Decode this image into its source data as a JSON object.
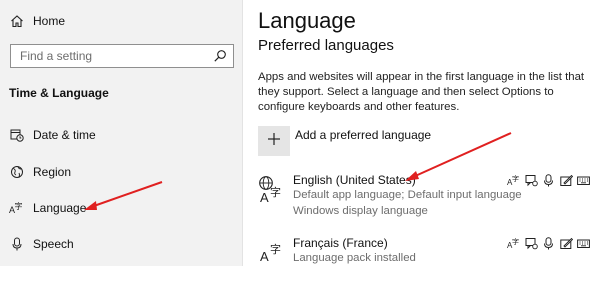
{
  "sidebar": {
    "home_label": "Home",
    "search_placeholder": "Find a setting",
    "section_title": "Time & Language",
    "items": [
      {
        "label": "Date & time",
        "icon": "calendar-clock-icon"
      },
      {
        "label": "Region",
        "icon": "globe-icon"
      },
      {
        "label": "Language",
        "icon": "language-icon"
      },
      {
        "label": "Speech",
        "icon": "microphone-icon"
      }
    ]
  },
  "main": {
    "title": "Language",
    "subtitle": "Preferred languages",
    "description": "Apps and websites will appear in the first language in the list that they support. Select a language and then select Options to configure keyboards and other features.",
    "add_label": "Add a preferred language",
    "languages": [
      {
        "name": "English (United States)",
        "line2": "Default app language; Default input language",
        "line3": "Windows display language",
        "features": [
          "language-pack-icon",
          "speech-recognition-icon",
          "microphone-icon",
          "handwriting-icon",
          "keyboard-icon"
        ]
      },
      {
        "name": "Français (France)",
        "line2": "Language pack installed",
        "features": [
          "language-pack-icon",
          "speech-recognition-icon",
          "microphone-icon",
          "handwriting-icon",
          "keyboard-icon"
        ]
      }
    ]
  },
  "colors": {
    "sidebar_bg": "#f2f2f2",
    "add_button_bg": "#e5e5e5",
    "annotation_arrow": "#e02020",
    "secondary_text": "#6d6d6d"
  }
}
